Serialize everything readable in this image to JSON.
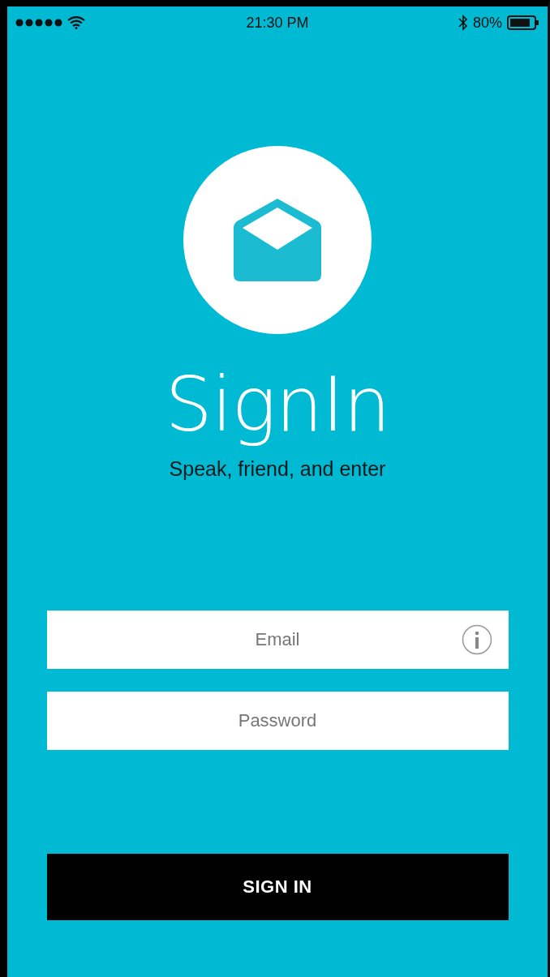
{
  "status_bar": {
    "time": "21:30 PM",
    "battery": "80%"
  },
  "title": "SignIn",
  "subtitle": "Speak, friend, and enter",
  "fields": [
    {
      "placeholder": "Email",
      "info": true
    },
    {
      "placeholder": "Password",
      "info": false
    }
  ],
  "button": "SIGN IN"
}
